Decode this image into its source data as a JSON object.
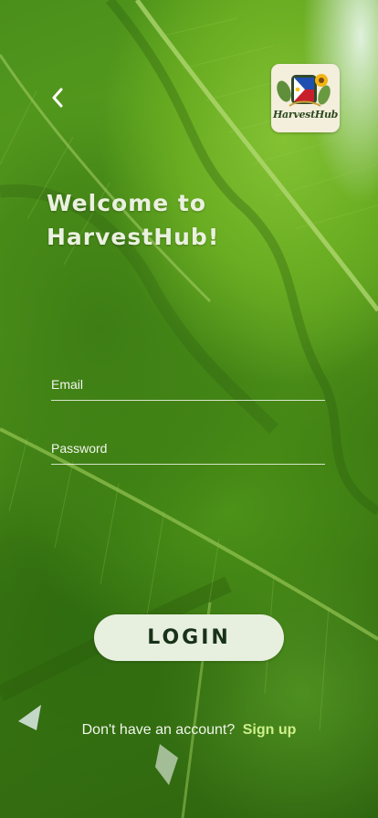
{
  "header": {
    "back_icon": "chevron-left-icon",
    "logo": {
      "text": "HarvestHub",
      "icon": "philippine-flag-sunflower-icon"
    }
  },
  "welcome": {
    "line1": "Welcome to",
    "line2": "HarvestHub!"
  },
  "form": {
    "email_placeholder": "Email",
    "password_placeholder": "Password",
    "login_label": "LOGIN"
  },
  "footer": {
    "prompt": "Don't have an account?",
    "signup_label": "Sign up"
  },
  "colors": {
    "leaf_green": "#4a8f1a",
    "text_light": "#eaf1df",
    "button_bg": "#e7efdf",
    "button_text": "#183218",
    "signup_link": "#cdf08a"
  }
}
